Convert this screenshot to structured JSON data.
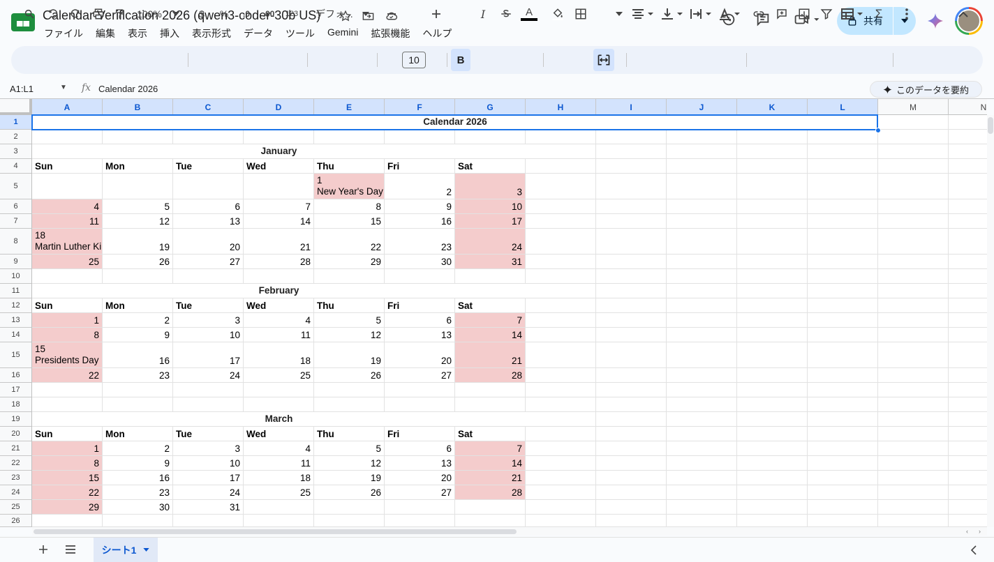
{
  "doc": {
    "title": "Calendar Verification 2026 (qwen3-coder-30b US)",
    "menu": [
      "ファイル",
      "編集",
      "表示",
      "挿入",
      "表示形式",
      "データ",
      "ツール",
      "Gemini",
      "拡張機能",
      "ヘルプ"
    ]
  },
  "header": {
    "share_label": "共有"
  },
  "toolbar": {
    "zoom": "100%",
    "currency": "$",
    "percent": "%",
    "dec_decrease": ".0",
    "dec_increase": ".00",
    "number_format": "123",
    "font": "デフォ...",
    "font_size": "10"
  },
  "formula_bar": {
    "name_box": "A1:L1",
    "content": "Calendar 2026",
    "summarize_label": "このデータを要約"
  },
  "columns": [
    "A",
    "B",
    "C",
    "D",
    "E",
    "F",
    "G",
    "H",
    "I",
    "J",
    "K",
    "L",
    "M",
    "N"
  ],
  "rows": [
    "1",
    "2",
    "3",
    "4",
    "5",
    "6",
    "7",
    "8",
    "9",
    "10",
    "11",
    "12",
    "13",
    "14",
    "15",
    "16",
    "17",
    "18",
    "19",
    "20",
    "21",
    "22",
    "23",
    "24",
    "25",
    "26"
  ],
  "sheet": {
    "title": "Calendar 2026",
    "day_headers": [
      "Sun",
      "Mon",
      "Tue",
      "Wed",
      "Thu",
      "Fri",
      "Sat"
    ],
    "months": [
      {
        "name": "January",
        "weeks": [
          [
            "",
            "",
            "",
            "",
            "1",
            "2",
            "3"
          ],
          [
            "4",
            "5",
            "6",
            "7",
            "8",
            "9",
            "10"
          ],
          [
            "11",
            "12",
            "13",
            "14",
            "15",
            "16",
            "17"
          ],
          [
            "18",
            "19",
            "20",
            "21",
            "22",
            "23",
            "24"
          ],
          [
            "25",
            "26",
            "27",
            "28",
            "29",
            "30",
            "31"
          ]
        ],
        "holidays": [
          {
            "week": 0,
            "day": 4,
            "label": "New Year's Day"
          },
          {
            "week": 3,
            "day": 0,
            "label": "Martin Luther Kir"
          }
        ]
      },
      {
        "name": "February",
        "weeks": [
          [
            "1",
            "2",
            "3",
            "4",
            "5",
            "6",
            "7"
          ],
          [
            "8",
            "9",
            "10",
            "11",
            "12",
            "13",
            "14"
          ],
          [
            "15",
            "16",
            "17",
            "18",
            "19",
            "20",
            "21"
          ],
          [
            "22",
            "23",
            "24",
            "25",
            "26",
            "27",
            "28"
          ]
        ],
        "holidays": [
          {
            "week": 2,
            "day": 0,
            "label": "Presidents Day"
          }
        ]
      },
      {
        "name": "March",
        "weeks": [
          [
            "1",
            "2",
            "3",
            "4",
            "5",
            "6",
            "7"
          ],
          [
            "8",
            "9",
            "10",
            "11",
            "12",
            "13",
            "14"
          ],
          [
            "15",
            "16",
            "17",
            "18",
            "19",
            "20",
            "21"
          ],
          [
            "22",
            "23",
            "24",
            "25",
            "26",
            "27",
            "28"
          ],
          [
            "29",
            "30",
            "31",
            "",
            "",
            "",
            ""
          ]
        ],
        "holidays": []
      }
    ]
  },
  "sheet_tab": {
    "label": "シート1"
  },
  "colors": {
    "weekend_fill": "#f4cccc",
    "selection": "#1a73e8",
    "share_bg": "#c2e7ff"
  }
}
